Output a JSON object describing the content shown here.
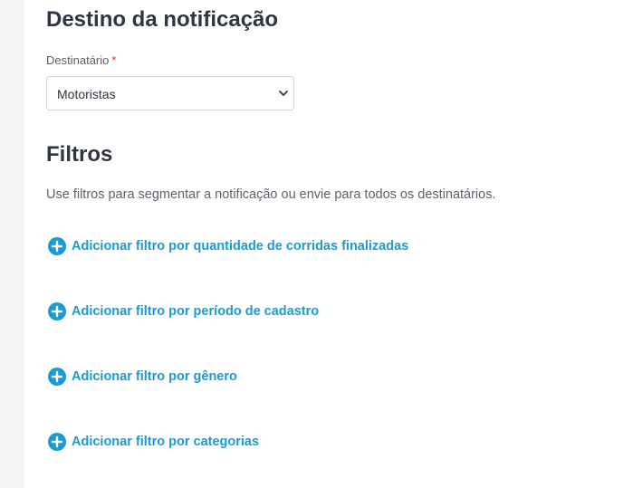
{
  "destino": {
    "title": "Destino da notificação",
    "recipient_label": "Destinatário",
    "required_mark": "*",
    "recipient_value": "Motoristas"
  },
  "filtros": {
    "title": "Filtros",
    "description": "Use filtros para segmentar a notificação ou envie para todos os destinatários.",
    "links": [
      {
        "label": "Adicionar filtro por quantidade de corridas finalizadas",
        "icon": "plus-circle-icon"
      },
      {
        "label": "Adicionar filtro por período de cadastro",
        "icon": "plus-circle-icon"
      },
      {
        "label": "Adicionar filtro por gênero",
        "icon": "plus-circle-icon"
      },
      {
        "label": "Adicionar filtro por categorias",
        "icon": "plus-circle-icon"
      }
    ]
  },
  "colors": {
    "accent": "#1c9ad6",
    "required": "#d63031",
    "heading": "#2f3542",
    "page_background": "#f4f5f7",
    "panel_background": "#ffffff"
  }
}
